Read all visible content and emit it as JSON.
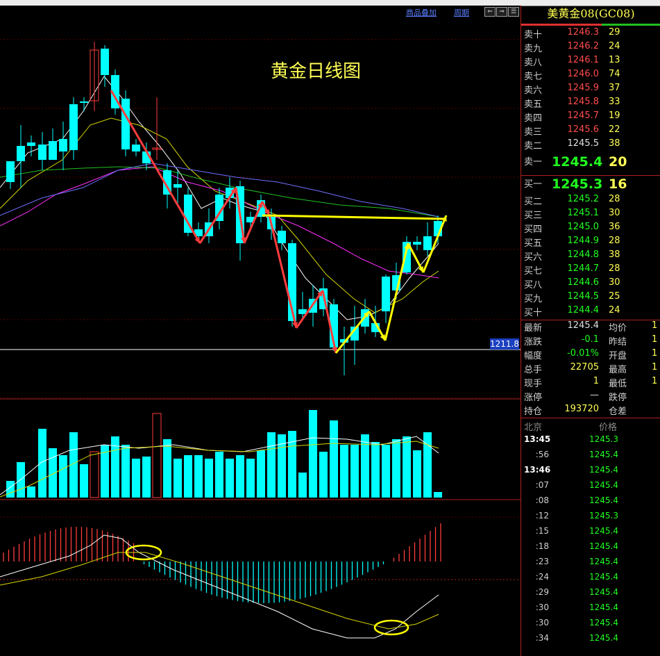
{
  "toolbar": {
    "overlay_label": "商品叠加",
    "period_label": "周期",
    "btn_left": "⇐",
    "btn_right": "⇒",
    "btn_menu": "☰"
  },
  "chart": {
    "title": "黄金日线图",
    "price_tag": "1211.8"
  },
  "symbol": {
    "title": "美黄金08(GC08)"
  },
  "order_book": {
    "asks": [
      {
        "label": "卖十",
        "price": "1246.3",
        "vol": "29"
      },
      {
        "label": "卖九",
        "price": "1246.2",
        "vol": "24"
      },
      {
        "label": "卖八",
        "price": "1246.1",
        "vol": "13"
      },
      {
        "label": "卖七",
        "price": "1246.0",
        "vol": "74"
      },
      {
        "label": "卖六",
        "price": "1245.9",
        "vol": "37"
      },
      {
        "label": "卖五",
        "price": "1245.8",
        "vol": "33"
      },
      {
        "label": "卖四",
        "price": "1245.7",
        "vol": "19"
      },
      {
        "label": "卖三",
        "price": "1245.6",
        "vol": "22"
      },
      {
        "label": "卖二",
        "price": "1245.5",
        "vol": "38"
      },
      {
        "label": "卖一",
        "price": "1245.4",
        "vol": "20"
      }
    ],
    "bids": [
      {
        "label": "买一",
        "price": "1245.3",
        "vol": "16"
      },
      {
        "label": "买二",
        "price": "1245.2",
        "vol": "28"
      },
      {
        "label": "买三",
        "price": "1245.1",
        "vol": "30"
      },
      {
        "label": "买四",
        "price": "1245.0",
        "vol": "36"
      },
      {
        "label": "买五",
        "price": "1244.9",
        "vol": "28"
      },
      {
        "label": "买六",
        "price": "1244.8",
        "vol": "38"
      },
      {
        "label": "买七",
        "price": "1244.7",
        "vol": "28"
      },
      {
        "label": "买八",
        "price": "1244.6",
        "vol": "30"
      },
      {
        "label": "买九",
        "price": "1244.5",
        "vol": "25"
      },
      {
        "label": "买十",
        "price": "1244.4",
        "vol": "24"
      }
    ]
  },
  "stats": [
    {
      "l1": "最新",
      "v1": "1245.4",
      "l2": "均价",
      "v2": "1"
    },
    {
      "l1": "涨跌",
      "v1": "-0.1",
      "l2": "昨结",
      "v2": "1"
    },
    {
      "l1": "幅度",
      "v1": "-0.01%",
      "l2": "开盘",
      "v2": "1"
    },
    {
      "l1": "总手",
      "v1": "22705",
      "l2": "最高",
      "v2": "1"
    },
    {
      "l1": "现手",
      "v1": "1",
      "l2": "最低",
      "v2": "1"
    },
    {
      "l1": "涨停",
      "v1": "—",
      "l2": "跌停",
      "v2": ""
    },
    {
      "l1": "持仓",
      "v1": "193720",
      "l2": "仓差",
      "v2": ""
    }
  ],
  "ticks": {
    "location": "北京",
    "price_header": "价格",
    "rows": [
      {
        "time": "13:45",
        "price": "1245.3"
      },
      {
        "time": ":56",
        "price": "1245.4"
      },
      {
        "time": "13:46",
        "price": "1245.4"
      },
      {
        "time": ":07",
        "price": "1245.4"
      },
      {
        "time": ":08",
        "price": "1245.4"
      },
      {
        "time": ":12",
        "price": "1245.3"
      },
      {
        "time": ":15",
        "price": "1245.4"
      },
      {
        "time": ":18",
        "price": "1245.4"
      },
      {
        "time": ":23",
        "price": "1245.4"
      },
      {
        "time": ":24",
        "price": "1245.4"
      },
      {
        "time": ":29",
        "price": "1245.4"
      },
      {
        "time": ":30",
        "price": "1245.4"
      },
      {
        "time": ":30",
        "price": "1245.4"
      },
      {
        "time": ":34",
        "price": "1245.4"
      }
    ]
  },
  "colors": {
    "up": "#ff3c3c",
    "down": "#00ffff",
    "arrow_red": "#ff3c3c",
    "arrow_yellow": "#ffff00",
    "ma_white": "#ffffff",
    "ma_yellow": "#d8d800",
    "ma_magenta": "#ff30ff",
    "ma_green": "#20c020",
    "ma_blue": "#7070ff"
  }
}
